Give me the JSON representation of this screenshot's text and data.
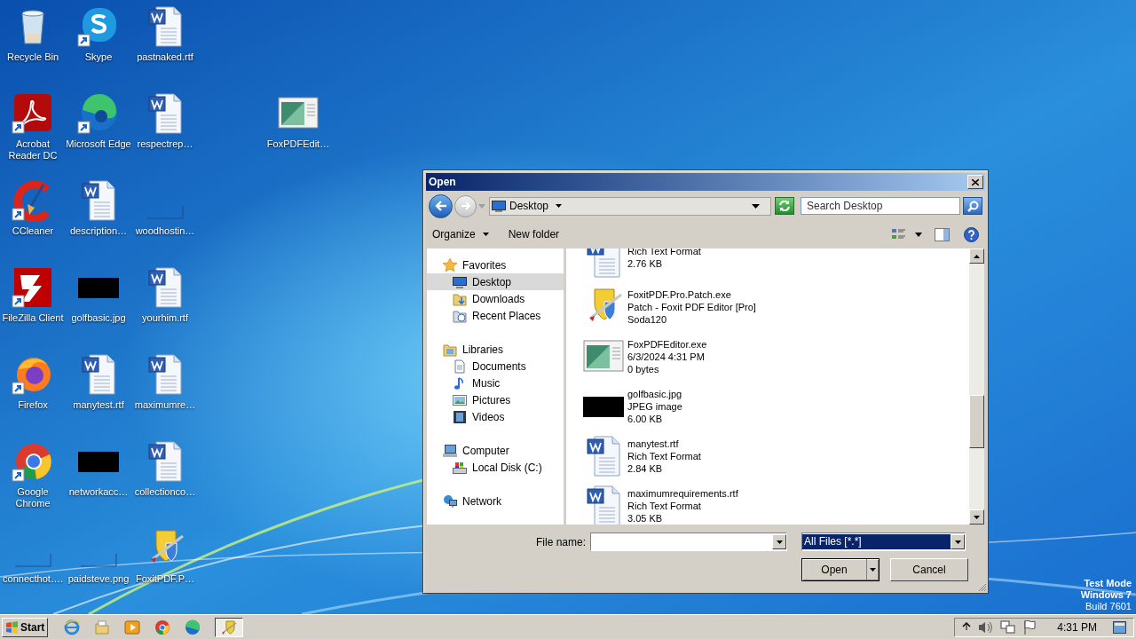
{
  "desktop": {
    "icons": [
      {
        "label": "Recycle Bin",
        "kind": "recycle",
        "shortcut": false
      },
      {
        "label": "Skype",
        "kind": "skype",
        "shortcut": true
      },
      {
        "label": "pastnaked.rtf",
        "kind": "word",
        "shortcut": false
      },
      {
        "label": "Acrobat Reader DC",
        "kind": "acrobat",
        "shortcut": true
      },
      {
        "label": "Microsoft Edge",
        "kind": "edge",
        "shortcut": true
      },
      {
        "label": "respectrep…",
        "kind": "word",
        "shortcut": false
      },
      {
        "label": "FoxPDFEdit…",
        "kind": "window",
        "shortcut": false
      },
      {
        "label": "CCleaner",
        "kind": "ccleaner",
        "shortcut": true
      },
      {
        "label": "description…",
        "kind": "word",
        "shortcut": false
      },
      {
        "label": "woodhostin…",
        "kind": "blank",
        "shortcut": false
      },
      {
        "label": "FileZilla Client",
        "kind": "filezilla",
        "shortcut": true
      },
      {
        "label": "golfbasic.jpg",
        "kind": "image",
        "shortcut": false
      },
      {
        "label": "yourhim.rtf",
        "kind": "word",
        "shortcut": false
      },
      {
        "label": "Firefox",
        "kind": "firefox",
        "shortcut": true
      },
      {
        "label": "manytest.rtf",
        "kind": "word",
        "shortcut": false
      },
      {
        "label": "maximumre…",
        "kind": "word",
        "shortcut": false
      },
      {
        "label": "Google Chrome",
        "kind": "chrome",
        "shortcut": true
      },
      {
        "label": "networkacc…",
        "kind": "image",
        "shortcut": false
      },
      {
        "label": "collectionco…",
        "kind": "word",
        "shortcut": false
      },
      {
        "label": "connecthot….",
        "kind": "blank",
        "shortcut": false
      },
      {
        "label": "paidsteve.png",
        "kind": "blank",
        "shortcut": false
      },
      {
        "label": "FoxitPDF.P…",
        "kind": "shield",
        "shortcut": false
      }
    ],
    "os_notice": [
      {
        "text": "Test Mode",
        "bold": true
      },
      {
        "text": "Windows 7",
        "bold": true
      },
      {
        "text": "Build 7601",
        "bold": false
      }
    ]
  },
  "dialog": {
    "title": "Open",
    "address": {
      "location": "Desktop"
    },
    "search": {
      "placeholder": "Search Desktop"
    },
    "toolbar": {
      "organize": "Organize",
      "new_folder": "New folder"
    },
    "nav": [
      {
        "label": "Favorites",
        "kind": "star",
        "selected": false,
        "children": [
          {
            "label": "Desktop",
            "kind": "desktop",
            "selected": true
          },
          {
            "label": "Downloads",
            "kind": "downloads",
            "selected": false
          },
          {
            "label": "Recent Places",
            "kind": "recent",
            "selected": false
          }
        ]
      },
      {
        "label": "Libraries",
        "kind": "library",
        "selected": false,
        "children": [
          {
            "label": "Documents",
            "kind": "documents",
            "selected": false
          },
          {
            "label": "Music",
            "kind": "music",
            "selected": false
          },
          {
            "label": "Pictures",
            "kind": "pictures",
            "selected": false
          },
          {
            "label": "Videos",
            "kind": "videos",
            "selected": false
          }
        ]
      },
      {
        "label": "Computer",
        "kind": "computer",
        "selected": false,
        "children": [
          {
            "label": "Local Disk (C:)",
            "kind": "disk",
            "selected": false
          }
        ]
      },
      {
        "label": "Network",
        "kind": "network",
        "selected": false
      }
    ],
    "files": [
      {
        "kind": "word",
        "lines": [
          "Rich Text Format",
          "2.76 KB"
        ]
      },
      {
        "kind": "shield",
        "lines": [
          "FoxitPDF.Pro.Patch.exe",
          "Patch - Foxit PDF Editor [Pro]",
          "Soda120"
        ]
      },
      {
        "kind": "window",
        "lines": [
          "FoxPDFEditor.exe",
          "6/3/2024 4:31 PM",
          "0 bytes"
        ]
      },
      {
        "kind": "image",
        "lines": [
          "golfbasic.jpg",
          "JPEG image",
          "6.00 KB"
        ]
      },
      {
        "kind": "word",
        "lines": [
          "manytest.rtf",
          "Rich Text Format",
          "2.84 KB"
        ]
      },
      {
        "kind": "word",
        "lines": [
          "maximumrequirements.rtf",
          "Rich Text Format",
          "3.05 KB"
        ]
      }
    ],
    "file_name": {
      "label": "File name:"
    },
    "file_type": {
      "value": "All Files [*.*]",
      "focused": true
    },
    "buttons": {
      "open": "Open",
      "cancel": "Cancel"
    }
  },
  "taskbar": {
    "start": "Start",
    "quick_launch": [
      {
        "kind": "ie"
      },
      {
        "kind": "explorer"
      },
      {
        "kind": "media"
      },
      {
        "kind": "chrome"
      },
      {
        "kind": "edge"
      }
    ],
    "tasks": [
      {
        "kind": "shield",
        "selected": true
      }
    ],
    "tray": [
      {
        "kind": "chevron"
      },
      {
        "kind": "speaker"
      },
      {
        "kind": "network"
      },
      {
        "kind": "flag"
      }
    ],
    "clock": "4:31 PM"
  }
}
